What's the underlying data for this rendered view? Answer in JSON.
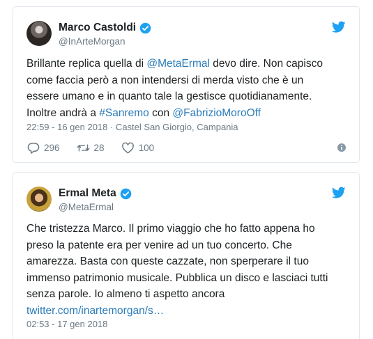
{
  "tweets": [
    {
      "author_name": "Marco Castoldi",
      "handle": "@InArteMorgan",
      "text_lines": [
        [
          {
            "t": "Brillante replica quella di ",
            "link": false
          },
          {
            "t": "@MetaErmal",
            "link": true
          },
          {
            "t": " devo dire. Non capisco",
            "link": false
          }
        ],
        [
          {
            "t": "come faccia però a non intendersi di merda visto che è un",
            "link": false
          }
        ],
        [
          {
            "t": "essere umano e in quanto tale la gestisce  quotidianamente.",
            "link": false
          }
        ],
        [
          {
            "t": "Inoltre andrà a ",
            "link": false
          },
          {
            "t": "#Sanremo",
            "link": true
          },
          {
            "t": " con ",
            "link": false
          },
          {
            "t": "@FabrizioMoroOff",
            "link": true
          }
        ]
      ],
      "meta": "22:59 - 16 gen 2018 · Castel San Giorgio, Campania",
      "replies": "296",
      "retweets": "28",
      "likes": "100"
    },
    {
      "author_name": "Ermal Meta",
      "handle": "@MetaErmal",
      "text_lines": [
        [
          {
            "t": "Che tristezza Marco. Il primo viaggio che ho fatto appena ho",
            "link": false
          }
        ],
        [
          {
            "t": "preso la patente era per venire ad un tuo concerto. Che",
            "link": false
          }
        ],
        [
          {
            "t": "amarezza. Basta con queste cazzate, non sperperare il tuo",
            "link": false
          }
        ],
        [
          {
            "t": "immenso patrimonio musicale. Pubblica un disco e lasciaci tutti",
            "link": false
          }
        ],
        [
          {
            "t": "senza parole. Io almeno ti aspetto ancora",
            "link": false
          }
        ],
        [
          {
            "t": "twitter.com/inartemorgan/s…",
            "link": true
          }
        ]
      ],
      "meta": "02:53 - 17 gen 2018"
    }
  ],
  "icons": {
    "verified": "verified-badge-icon",
    "twitter": "twitter-bird-icon",
    "reply": "reply-icon",
    "retweet": "retweet-icon",
    "like": "heart-icon",
    "info": "info-icon"
  },
  "colors": {
    "link": "#2b7bb9",
    "verified": "#1da1f2",
    "muted": "#697882",
    "border": "#e1e8ed"
  }
}
